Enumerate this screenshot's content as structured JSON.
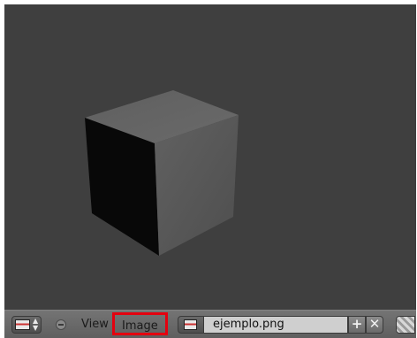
{
  "header": {
    "editor_type_icon": "image-editor-icon",
    "menu": {
      "view_label": "View",
      "image_label": "Image"
    },
    "image_datablock": {
      "browse_icon": "image-browse-icon",
      "name": "ejemplo.png",
      "new_icon": "plus-icon",
      "new_label": "+",
      "unlink_icon": "close-icon",
      "unlink_label": "✕",
      "pack_icon": "pack-icon"
    },
    "highlight_color": "#e4000f"
  },
  "viewport": {
    "background_color": "#3f3f3f",
    "object": "cube"
  }
}
